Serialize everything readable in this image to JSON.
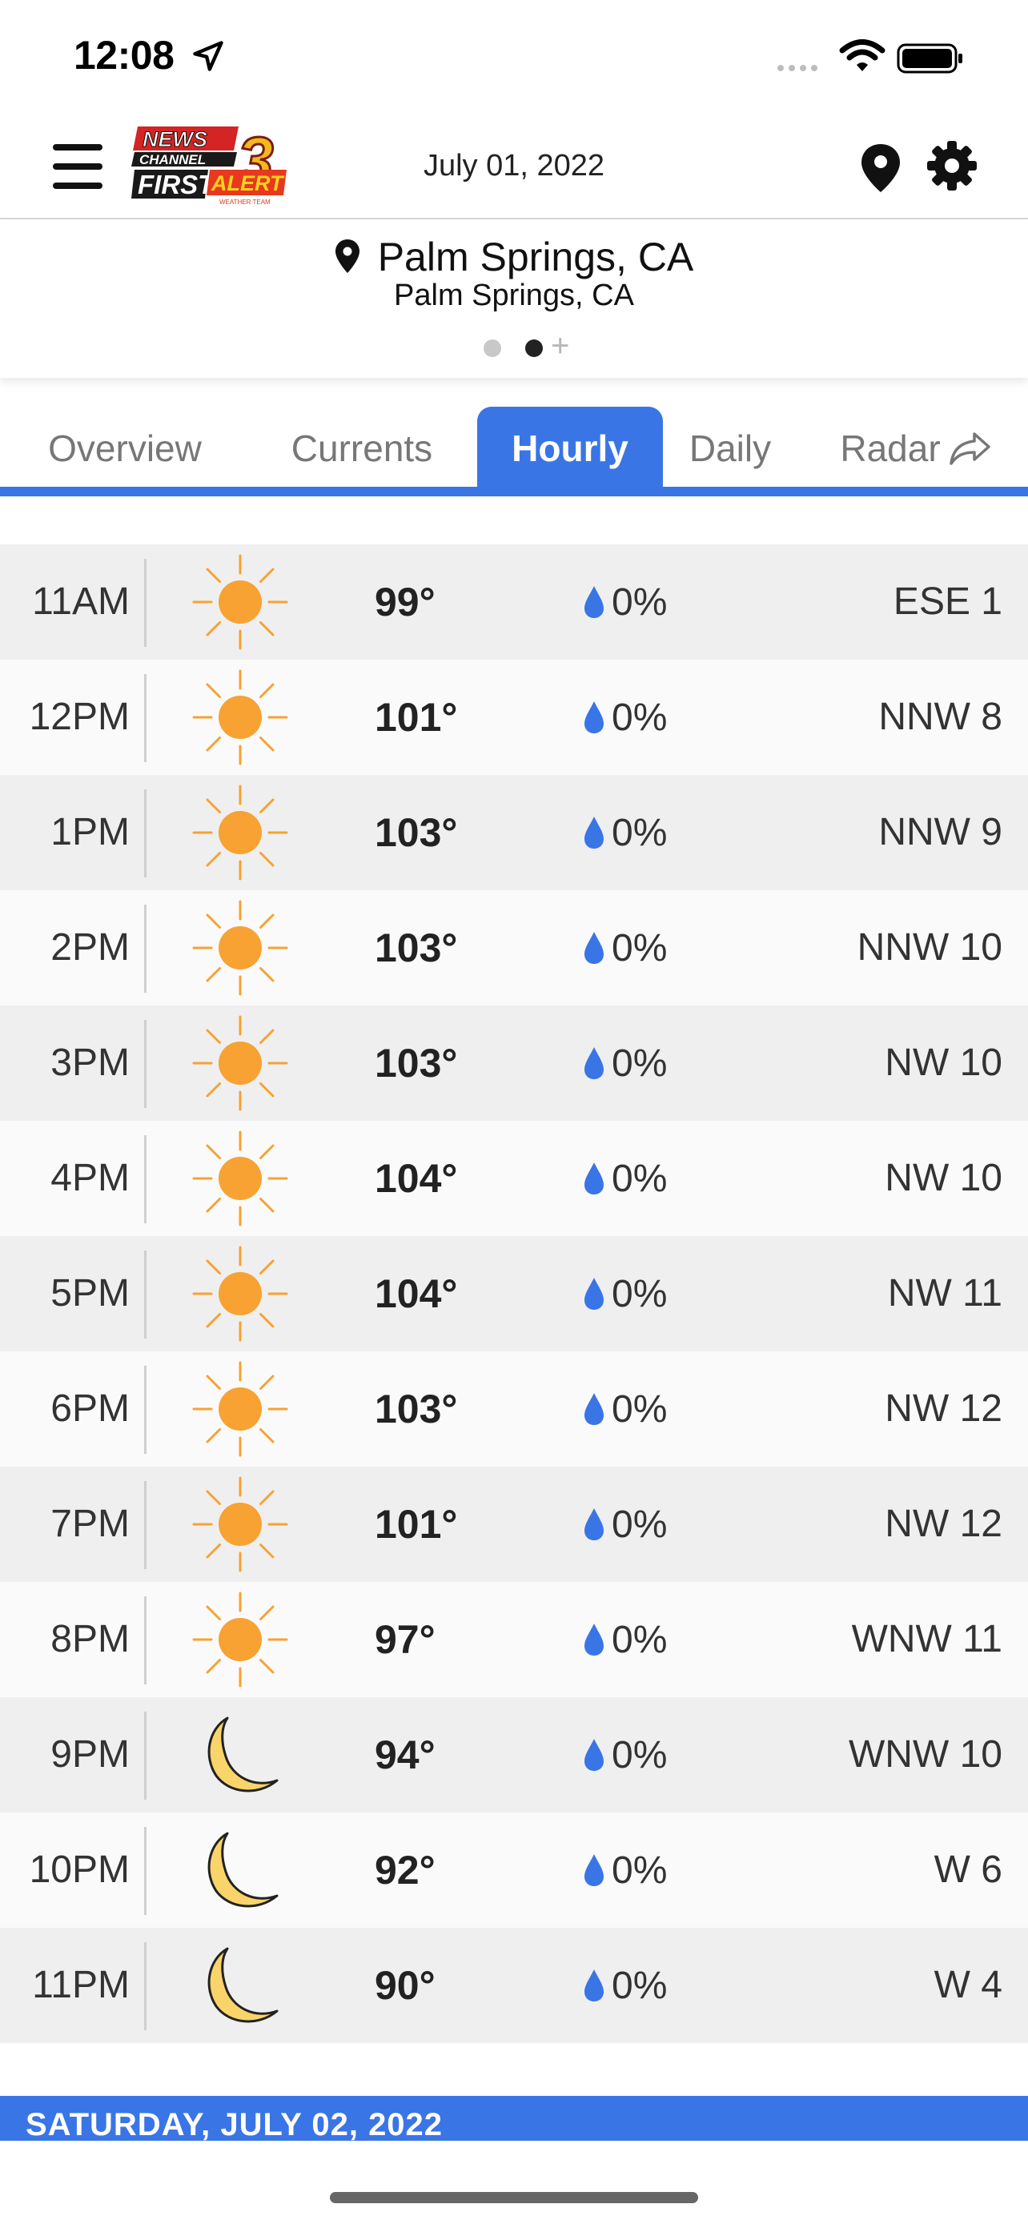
{
  "status_bar": {
    "time": "12:08",
    "icons": [
      "location-arrow-icon",
      "cellular-signal-icon",
      "wifi-icon",
      "battery-icon"
    ]
  },
  "header": {
    "date": "July 01, 2022",
    "logo_text": {
      "line1": "NEWS",
      "line2": "CHANNEL",
      "number": "3",
      "line3": "FIRST",
      "line4": "ALERT",
      "tagline": "WEATHER TEAM"
    },
    "icons": [
      "hamburger-menu-icon",
      "map-pin-icon",
      "gear-icon"
    ]
  },
  "location": {
    "name": "Palm Springs, CA",
    "subtitle": "Palm Springs, CA",
    "pages": {
      "count": 2,
      "active_index": 1,
      "add_symbol": "+"
    }
  },
  "tabs": [
    {
      "label": "Overview",
      "active": false
    },
    {
      "label": "Currents",
      "active": false
    },
    {
      "label": "Hourly",
      "active": true
    },
    {
      "label": "Daily",
      "active": false
    },
    {
      "label": "Radar",
      "active": false,
      "icon": "share-arrow-icon"
    }
  ],
  "hourly": [
    {
      "time": "11AM",
      "icon": "sun",
      "temp": "99°",
      "precip": "0%",
      "wind": "ESE 1"
    },
    {
      "time": "12PM",
      "icon": "sun",
      "temp": "101°",
      "precip": "0%",
      "wind": "NNW 8"
    },
    {
      "time": "1PM",
      "icon": "sun",
      "temp": "103°",
      "precip": "0%",
      "wind": "NNW 9"
    },
    {
      "time": "2PM",
      "icon": "sun",
      "temp": "103°",
      "precip": "0%",
      "wind": "NNW 10"
    },
    {
      "time": "3PM",
      "icon": "sun",
      "temp": "103°",
      "precip": "0%",
      "wind": "NW 10"
    },
    {
      "time": "4PM",
      "icon": "sun",
      "temp": "104°",
      "precip": "0%",
      "wind": "NW 10"
    },
    {
      "time": "5PM",
      "icon": "sun",
      "temp": "104°",
      "precip": "0%",
      "wind": "NW 11"
    },
    {
      "time": "6PM",
      "icon": "sun",
      "temp": "103°",
      "precip": "0%",
      "wind": "NW 12"
    },
    {
      "time": "7PM",
      "icon": "sun",
      "temp": "101°",
      "precip": "0%",
      "wind": "NW 12"
    },
    {
      "time": "8PM",
      "icon": "sun",
      "temp": "97°",
      "precip": "0%",
      "wind": "WNW 11"
    },
    {
      "time": "9PM",
      "icon": "moon",
      "temp": "94°",
      "precip": "0%",
      "wind": "WNW 10"
    },
    {
      "time": "10PM",
      "icon": "moon",
      "temp": "92°",
      "precip": "0%",
      "wind": "W 6"
    },
    {
      "time": "11PM",
      "icon": "moon",
      "temp": "90°",
      "precip": "0%",
      "wind": "W 4"
    }
  ],
  "next_day_header": "SATURDAY, JULY 02, 2022",
  "colors": {
    "accent_blue": "#3a75e6",
    "sun_orange": "#f7a232",
    "moon_yellow": "#f9d46a",
    "drop_blue": "#3a75e6",
    "row_alt": "#efefef"
  }
}
